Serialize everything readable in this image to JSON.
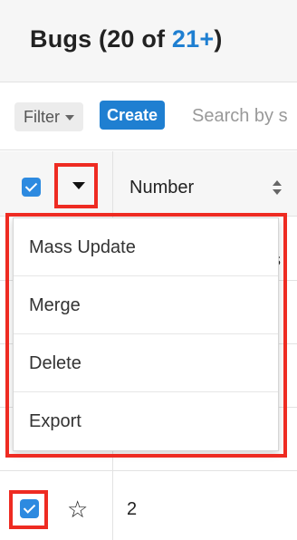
{
  "header": {
    "title_prefix": "Bugs (20 of ",
    "title_count": "21+",
    "title_suffix": ")"
  },
  "toolbar": {
    "filter_label": "Filter",
    "create_label": "Create",
    "search_placeholder": "Search by s"
  },
  "table": {
    "column_header": "Number",
    "row_peek_text": "s",
    "rows": [
      {
        "number": "2",
        "checked": true
      }
    ]
  },
  "actions_menu": {
    "items": [
      {
        "label": "Mass Update"
      },
      {
        "label": "Merge"
      },
      {
        "label": "Delete"
      },
      {
        "label": "Export"
      }
    ]
  },
  "colors": {
    "accent": "#1f7fd1",
    "checkbox": "#2d8ae0",
    "highlight": "#ee2b22",
    "header_bg": "#f6f6f6"
  },
  "icons": {
    "caret": "chevron-down-icon",
    "sort": "sort-icon",
    "favorite": "star-icon",
    "checkbox": "checkbox-icon"
  }
}
